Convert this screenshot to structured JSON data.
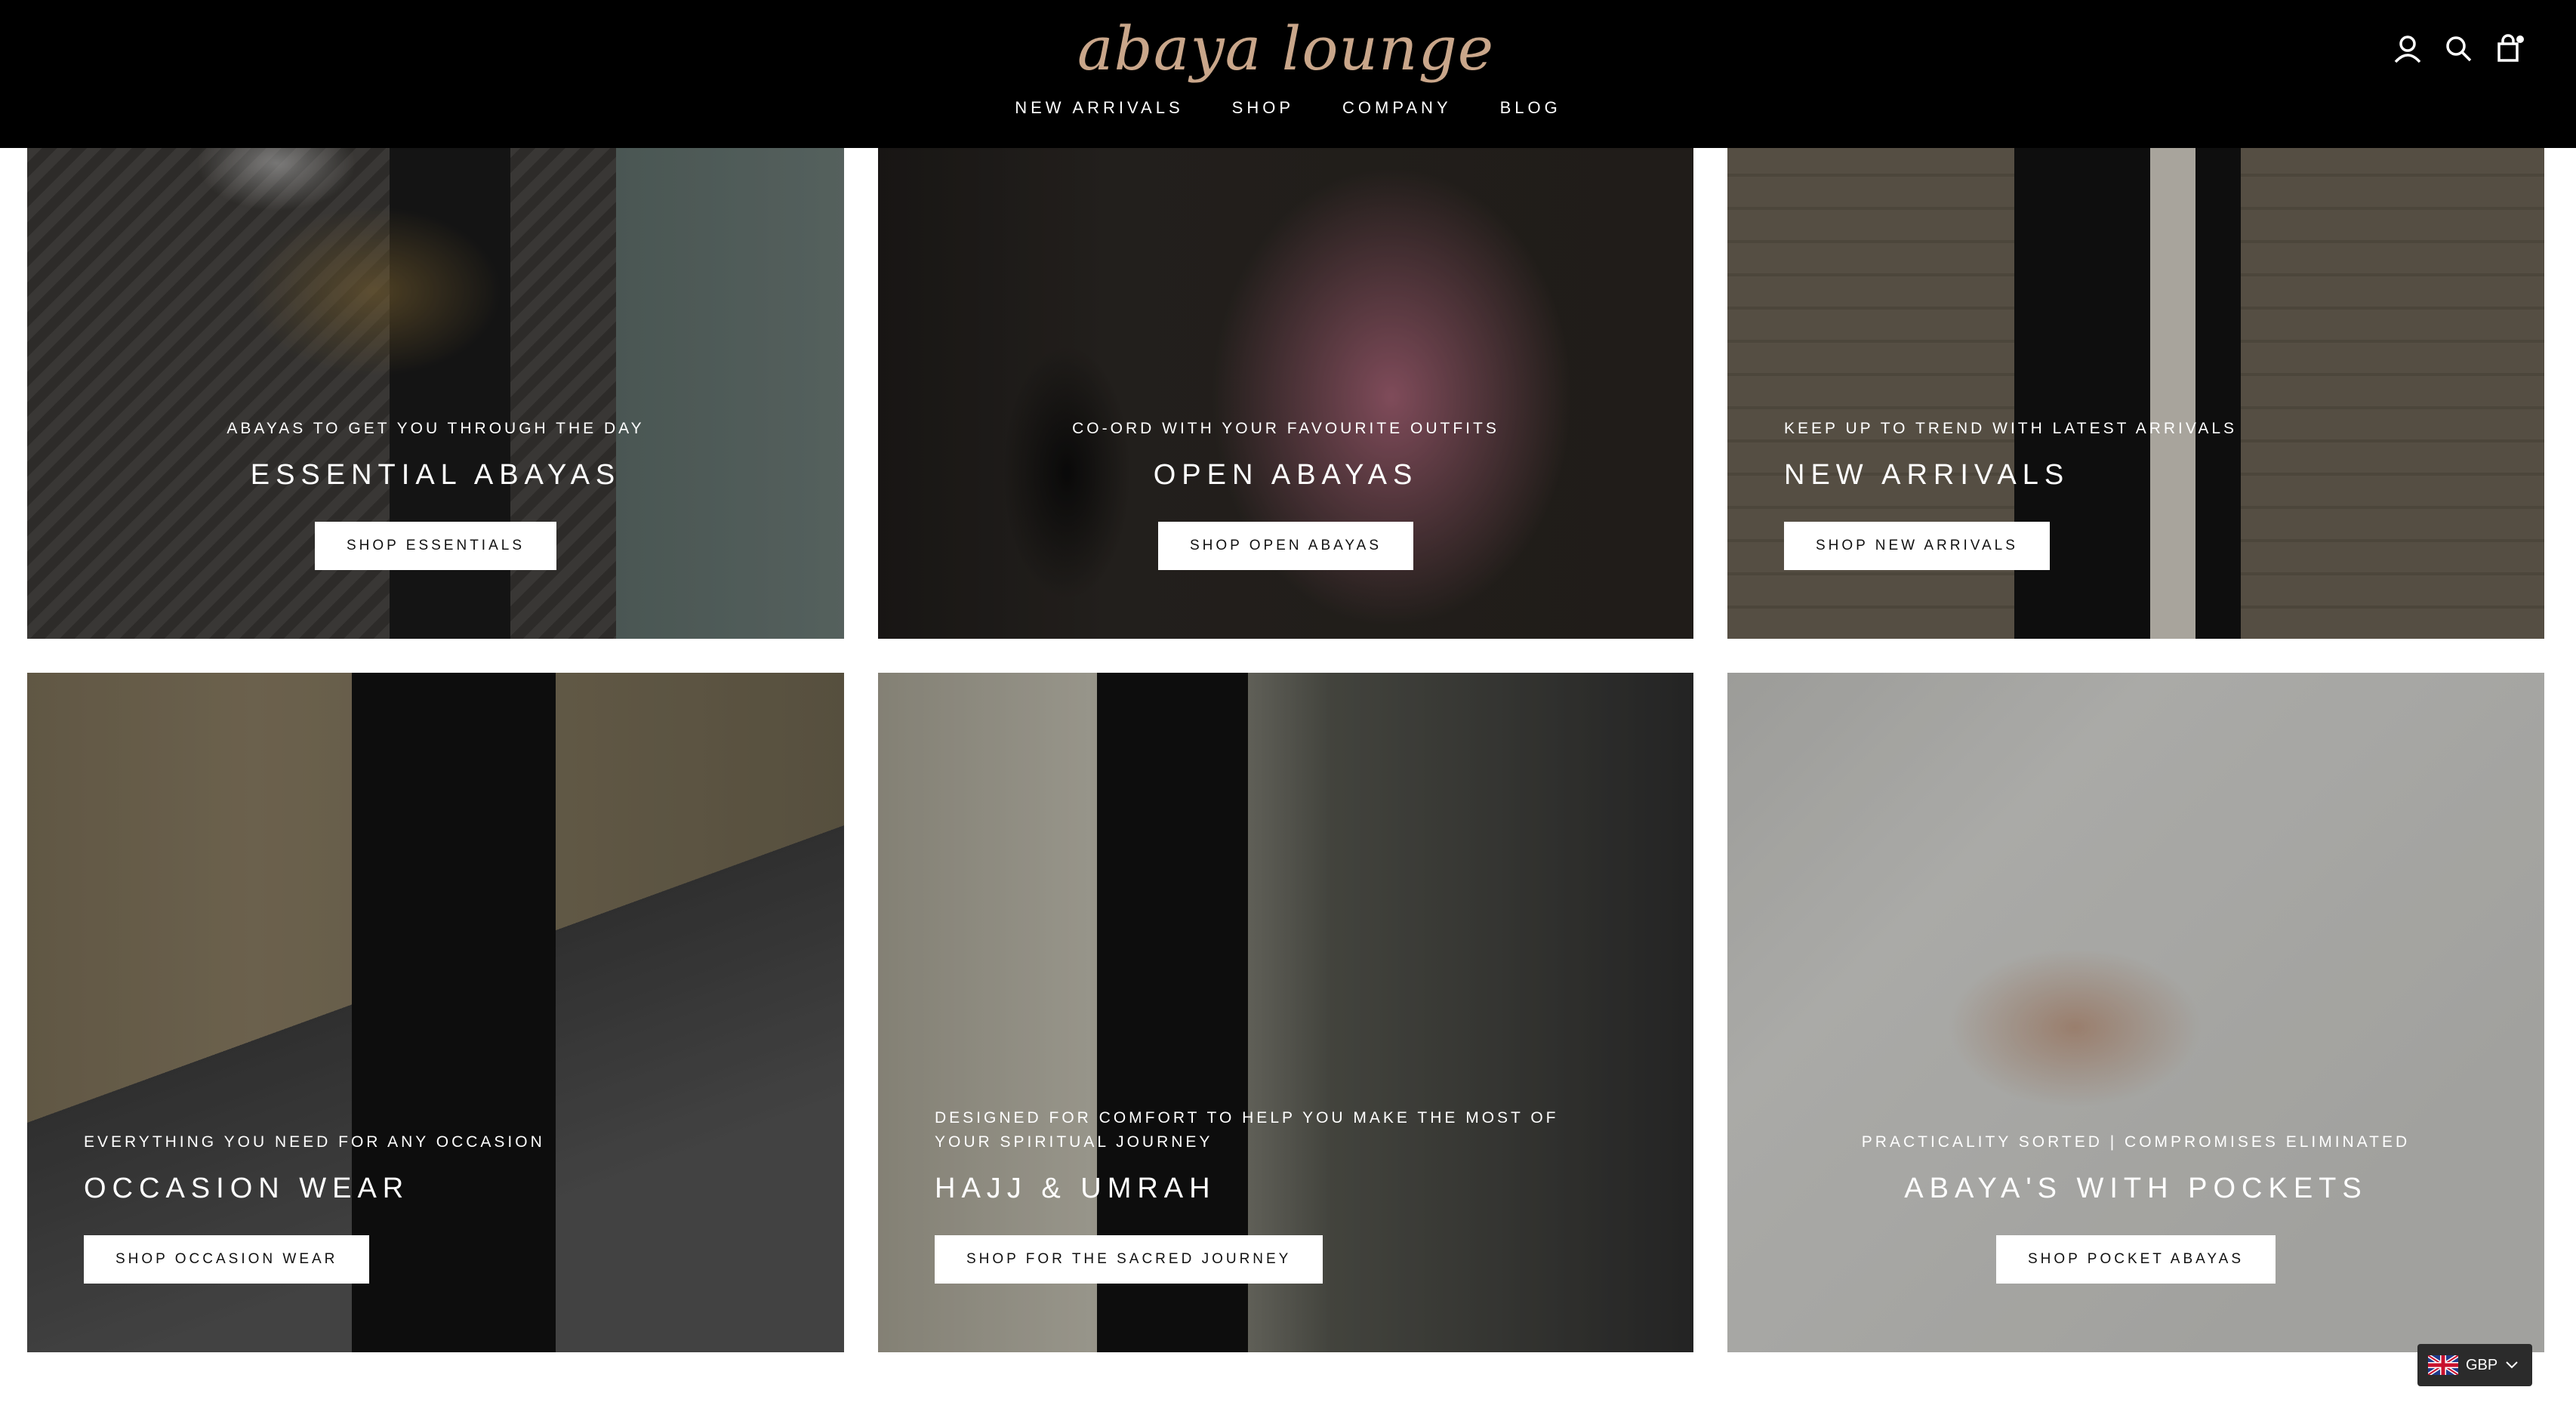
{
  "brand": {
    "logo_text": "abaya lounge"
  },
  "nav": {
    "items": [
      "NEW ARRIVALS",
      "SHOP",
      "COMPANY",
      "BLOG"
    ]
  },
  "header_icons": [
    "account-icon",
    "search-icon",
    "cart-icon"
  ],
  "tiles": [
    {
      "subtitle": "ABAYAS TO GET YOU THROUGH THE DAY",
      "title": "ESSENTIAL ABAYAS",
      "button": "SHOP ESSENTIALS"
    },
    {
      "subtitle": "CO-ORD WITH YOUR FAVOURITE OUTFITS",
      "title": "OPEN ABAYAS",
      "button": "SHOP OPEN ABAYAS"
    },
    {
      "subtitle": "KEEP UP TO TREND WITH LATEST ARRIVALS",
      "title": "NEW ARRIVALS",
      "button": "SHOP NEW ARRIVALS"
    },
    {
      "subtitle": "EVERYTHING YOU NEED FOR ANY OCCASION",
      "title": "OCCASION WEAR",
      "button": "SHOP OCCASION WEAR"
    },
    {
      "subtitle": "DESIGNED FOR COMFORT TO HELP YOU MAKE THE MOST OF YOUR SPIRITUAL JOURNEY",
      "title": "HAJJ & UMRAH",
      "button": "SHOP FOR THE SACRED JOURNEY"
    },
    {
      "subtitle": "PRACTICALITY SORTED | COMPROMISES ELIMINATED",
      "title": "ABAYA'S WITH POCKETS",
      "button": "SHOP POCKET ABAYAS"
    }
  ],
  "currency": {
    "code": "GBP"
  },
  "colors": {
    "header_bg": "#000000",
    "logo": "#c9a68a",
    "button_bg": "#ffffff"
  }
}
